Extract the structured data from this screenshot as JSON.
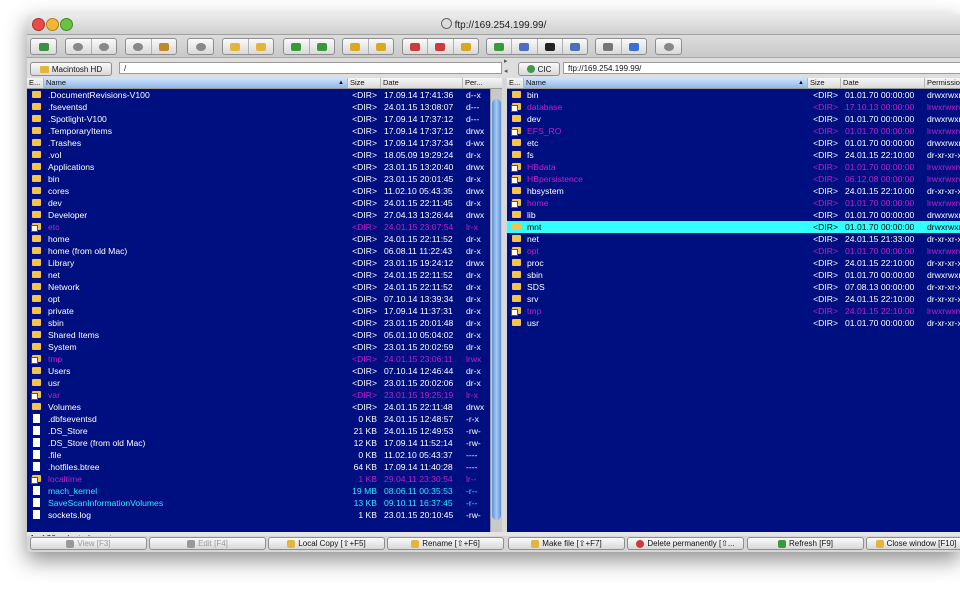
{
  "window": {
    "title": "ftp://169.254.199.99/"
  },
  "toolbar": {
    "groups": [
      {
        "icons": [
          "new-window-icon"
        ]
      },
      {
        "icons": [
          "back-icon",
          "forward-icon"
        ]
      },
      {
        "icons": [
          "root-icon",
          "home-icon"
        ]
      },
      {
        "icons": [
          "refresh-icon"
        ]
      },
      {
        "icons": [
          "new-folder-icon",
          "new-file-icon"
        ]
      },
      {
        "icons": [
          "sync-icon",
          "compare-icon"
        ]
      },
      {
        "icons": [
          "bookmark-icon",
          "bookmarks-list-icon"
        ]
      },
      {
        "icons": [
          "favorite-remove-icon",
          "favorite-icon",
          "key-icon"
        ]
      },
      {
        "icons": [
          "connect-icon",
          "network-icon",
          "terminal-icon",
          "mail-icon"
        ]
      },
      {
        "icons": [
          "tools-icon",
          "info-icon"
        ]
      },
      {
        "icons": [
          "settings-icon"
        ]
      }
    ]
  },
  "left": {
    "volume": "Macintosh HD",
    "path": "/",
    "columns": [
      "E...",
      "Name",
      "Size",
      "Date",
      "Per..."
    ],
    "rows": [
      {
        "name": ".DocumentRevisions-V100",
        "size": "<DIR>",
        "date": "17.09.14 17:41:36",
        "perm": "d--x",
        "icon": "folder",
        "color": "#ffffff"
      },
      {
        "name": ".fseventsd",
        "size": "<DIR>",
        "date": "24.01.15 13:08:07",
        "perm": "d---",
        "icon": "folder",
        "color": "#ffffff"
      },
      {
        "name": ".Spotlight-V100",
        "size": "<DIR>",
        "date": "17.09.14 17:37:12",
        "perm": "d---",
        "icon": "folder",
        "color": "#ffffff"
      },
      {
        "name": ".TemporaryItems",
        "size": "<DIR>",
        "date": "17.09.14 17:37:12",
        "perm": "drwx",
        "icon": "folder",
        "color": "#ffffff"
      },
      {
        "name": ".Trashes",
        "size": "<DIR>",
        "date": "17.09.14 17:37:34",
        "perm": "d-wx",
        "icon": "folder",
        "color": "#ffffff"
      },
      {
        "name": ".vol",
        "size": "<DIR>",
        "date": "18.05.09 19:29:24",
        "perm": "dr-x",
        "icon": "folder",
        "color": "#ffffff"
      },
      {
        "name": "Applications",
        "size": "<DIR>",
        "date": "23.01.15 13:20:40",
        "perm": "drwx",
        "icon": "folder",
        "color": "#ffffff"
      },
      {
        "name": "bin",
        "size": "<DIR>",
        "date": "23.01.15 20:01:45",
        "perm": "dr-x",
        "icon": "folder",
        "color": "#ffffff"
      },
      {
        "name": "cores",
        "size": "<DIR>",
        "date": "11.02.10 05:43:35",
        "perm": "drwx",
        "icon": "folder",
        "color": "#ffffff"
      },
      {
        "name": "dev",
        "size": "<DIR>",
        "date": "24.01.15 22:11:45",
        "perm": "dr-x",
        "icon": "folder",
        "color": "#ffffff"
      },
      {
        "name": "Developer",
        "size": "<DIR>",
        "date": "27.04.13 13:26:44",
        "perm": "drwx",
        "icon": "folder",
        "color": "#ffffff"
      },
      {
        "name": "etc",
        "size": "<DIR>",
        "date": "24.01.15 23:07:54",
        "perm": "lr-x",
        "icon": "link",
        "color": "#c020c8"
      },
      {
        "name": "home",
        "size": "<DIR>",
        "date": "24.01.15 22:11:52",
        "perm": "dr-x",
        "icon": "folder",
        "color": "#ffffff"
      },
      {
        "name": "home (from old Mac)",
        "size": "<DIR>",
        "date": "06.08.11 11:22:43",
        "perm": "dr-x",
        "icon": "folder",
        "color": "#ffffff"
      },
      {
        "name": "Library",
        "size": "<DIR>",
        "date": "23.01.15 19:24:12",
        "perm": "drwx",
        "icon": "folder",
        "color": "#ffffff"
      },
      {
        "name": "net",
        "size": "<DIR>",
        "date": "24.01.15 22:11:52",
        "perm": "dr-x",
        "icon": "folder",
        "color": "#ffffff"
      },
      {
        "name": "Network",
        "size": "<DIR>",
        "date": "24.01.15 22:11:52",
        "perm": "dr-x",
        "icon": "folder",
        "color": "#ffffff"
      },
      {
        "name": "opt",
        "size": "<DIR>",
        "date": "07.10.14 13:39:34",
        "perm": "dr-x",
        "icon": "folder",
        "color": "#ffffff"
      },
      {
        "name": "private",
        "size": "<DIR>",
        "date": "17.09.14 11:37:31",
        "perm": "dr-x",
        "icon": "folder",
        "color": "#ffffff"
      },
      {
        "name": "sbin",
        "size": "<DIR>",
        "date": "23.01.15 20:01:48",
        "perm": "dr-x",
        "icon": "folder",
        "color": "#ffffff"
      },
      {
        "name": "Shared Items",
        "size": "<DIR>",
        "date": "05.01.10 05:04:02",
        "perm": "dr-x",
        "icon": "folder",
        "color": "#ffffff"
      },
      {
        "name": "System",
        "size": "<DIR>",
        "date": "23.01.15 20:02:59",
        "perm": "dr-x",
        "icon": "folder",
        "color": "#ffffff"
      },
      {
        "name": "tmp",
        "size": "<DIR>",
        "date": "24.01.15 23:06:11",
        "perm": "lrwx",
        "icon": "link",
        "color": "#c020c8"
      },
      {
        "name": "Users",
        "size": "<DIR>",
        "date": "07.10.14 12:46:44",
        "perm": "dr-x",
        "icon": "folder",
        "color": "#ffffff"
      },
      {
        "name": "usr",
        "size": "<DIR>",
        "date": "23.01.15 20:02:06",
        "perm": "dr-x",
        "icon": "folder",
        "color": "#ffffff"
      },
      {
        "name": "var",
        "size": "<DIR>",
        "date": "23.01.15 19:25:19",
        "perm": "lr-x",
        "icon": "link",
        "color": "#c020c8"
      },
      {
        "name": "Volumes",
        "size": "<DIR>",
        "date": "24.01.15 22:11:48",
        "perm": "drwx",
        "icon": "folder",
        "color": "#ffffff"
      },
      {
        "name": ".dbfseventsd",
        "size": "0 KB",
        "date": "24.01.15 12:48:57",
        "perm": "-r-x",
        "icon": "file",
        "color": "#ffffff"
      },
      {
        "name": ".DS_Store",
        "size": "21 KB",
        "date": "24.01.15 12:49:53",
        "perm": "-rw-",
        "icon": "file",
        "color": "#ffffff"
      },
      {
        "name": ".DS_Store (from old Mac)",
        "size": "12 KB",
        "date": "17.09.14 11:52:14",
        "perm": "-rw-",
        "icon": "file",
        "color": "#ffffff"
      },
      {
        "name": ".file",
        "size": "0 KB",
        "date": "11.02.10 05:43:37",
        "perm": "----",
        "icon": "file",
        "color": "#ffffff"
      },
      {
        "name": ".hotfiles.btree",
        "size": "64 KB",
        "date": "17.09.14 11:40:28",
        "perm": "----",
        "icon": "file",
        "color": "#ffffff"
      },
      {
        "name": "localtime",
        "size": "1 KB",
        "date": "29.04.11 23:30:54",
        "perm": "lr--",
        "icon": "link",
        "color": "#c020c8"
      },
      {
        "name": "mach_kernel",
        "size": "19 MB",
        "date": "08.06.11 00:35:53",
        "perm": "-r--",
        "icon": "file",
        "color": "#33e6ff"
      },
      {
        "name": "SaveScanInformationVolumes",
        "size": "13 KB",
        "date": "09.10.11 16:37:45",
        "perm": "-r--",
        "icon": "file",
        "color": "#33e6ff"
      },
      {
        "name": "sockets.log",
        "size": "1 KB",
        "date": "23.01.15 20:10:45",
        "perm": "-rw-",
        "icon": "file",
        "color": "#ffffff"
      }
    ]
  },
  "right": {
    "volume": "CIC",
    "path": "ftp://169.254.199.99/",
    "columns": [
      "E...",
      "Name",
      "Size",
      "Date",
      "Permissions"
    ],
    "rows": [
      {
        "name": "bin",
        "size": "<DIR>",
        "date": "01.01.70 00:00:00",
        "perm": "drwxrwxr-x",
        "icon": "folder",
        "color": "#ffffff"
      },
      {
        "name": "database",
        "size": "<DIR>",
        "date": "17.10.13 00:00:00",
        "perm": "lrwxrwxrwx",
        "icon": "link",
        "color": "#c020c8"
      },
      {
        "name": "dev",
        "size": "<DIR>",
        "date": "01.01.70 00:00:00",
        "perm": "drwxrwxr-x",
        "icon": "folder",
        "color": "#ffffff"
      },
      {
        "name": "EFS_RO",
        "size": "<DIR>",
        "date": "01.01.70 00:00:00",
        "perm": "lrwxrwxrwx",
        "icon": "link",
        "color": "#c020c8"
      },
      {
        "name": "etc",
        "size": "<DIR>",
        "date": "01.01.70 00:00:00",
        "perm": "drwxrwxr-x",
        "icon": "folder",
        "color": "#ffffff"
      },
      {
        "name": "fs",
        "size": "<DIR>",
        "date": "24.01.15 22:10:00",
        "perm": "dr-xr-xr-x",
        "icon": "folder",
        "color": "#ffffff"
      },
      {
        "name": "HBdata",
        "size": "<DIR>",
        "date": "01.01.70 00:00:00",
        "perm": "lrwxrwxrwx",
        "icon": "link",
        "color": "#c020c8"
      },
      {
        "name": "HBpersistence",
        "size": "<DIR>",
        "date": "06.12.08 00:00:00",
        "perm": "lrwxrwxrwx",
        "icon": "link",
        "color": "#c020c8"
      },
      {
        "name": "hbsystem",
        "size": "<DIR>",
        "date": "24.01.15 22:10:00",
        "perm": "dr-xr-xr-x",
        "icon": "folder",
        "color": "#ffffff"
      },
      {
        "name": "home",
        "size": "<DIR>",
        "date": "01.01.70 00:00:00",
        "perm": "lrwxrwxrwx",
        "icon": "link",
        "color": "#c020c8"
      },
      {
        "name": "lib",
        "size": "<DIR>",
        "date": "01.01.70 00:00:00",
        "perm": "drwxrwxr-x",
        "icon": "folder",
        "color": "#ffffff"
      },
      {
        "name": "mnt",
        "size": "<DIR>",
        "date": "01.01.70 00:00:00",
        "perm": "drwxrwxr-x",
        "icon": "folder",
        "color": "#000000",
        "selected": true
      },
      {
        "name": "net",
        "size": "<DIR>",
        "date": "24.01.15 21:33:00",
        "perm": "dr-xr-xr-x",
        "icon": "folder",
        "color": "#ffffff"
      },
      {
        "name": "opt",
        "size": "<DIR>",
        "date": "01.01.70 00:00:00",
        "perm": "lrwxrwxrwx",
        "icon": "link",
        "color": "#c020c8"
      },
      {
        "name": "proc",
        "size": "<DIR>",
        "date": "24.01.15 22:10:00",
        "perm": "dr-xr-xr-x",
        "icon": "folder",
        "color": "#ffffff"
      },
      {
        "name": "sbin",
        "size": "<DIR>",
        "date": "01.01.70 00:00:00",
        "perm": "drwxrwxr-x",
        "icon": "folder",
        "color": "#ffffff"
      },
      {
        "name": "SDS",
        "size": "<DIR>",
        "date": "07.08.13 00:00:00",
        "perm": "dr-xr-xr-x",
        "icon": "folder",
        "color": "#ffffff"
      },
      {
        "name": "srv",
        "size": "<DIR>",
        "date": "24.01.15 22:10:00",
        "perm": "dr-xr-xr-x",
        "icon": "folder",
        "color": "#ffffff"
      },
      {
        "name": "tmp",
        "size": "<DIR>",
        "date": "24.01.15 22:10:00",
        "perm": "lrwxrwxrwx",
        "icon": "link",
        "color": "#c020c8"
      },
      {
        "name": "usr",
        "size": "<DIR>",
        "date": "01.01.70 00:00:00",
        "perm": "dr-xr-xr-x",
        "icon": "folder",
        "color": "#ffffff"
      }
    ]
  },
  "status": "1 of 20 selected - mnt",
  "buttons": [
    {
      "label": "View [F3]",
      "icon": "view-icon",
      "enabled": false
    },
    {
      "label": "Edit [F4]",
      "icon": "edit-icon",
      "enabled": false
    },
    {
      "label": "Local Copy [⇧+F5]",
      "icon": "copy-icon",
      "enabled": true
    },
    {
      "label": "Rename [⇧+F6]",
      "icon": "rename-icon",
      "enabled": true
    },
    {
      "label": "Make file [⇧+F7]",
      "icon": "make-file-icon",
      "enabled": true
    },
    {
      "label": "Delete permanently [⇧...",
      "icon": "delete-icon",
      "enabled": true
    },
    {
      "label": "Refresh [F9]",
      "icon": "refresh-icon",
      "enabled": true
    },
    {
      "label": "Close window [F10]",
      "icon": "close-window-icon",
      "enabled": true
    }
  ],
  "colors": {
    "list_bg": "#000f80",
    "selected_row": "#33ffff",
    "link_text": "#c020c8",
    "executable_text": "#33e6ff"
  }
}
